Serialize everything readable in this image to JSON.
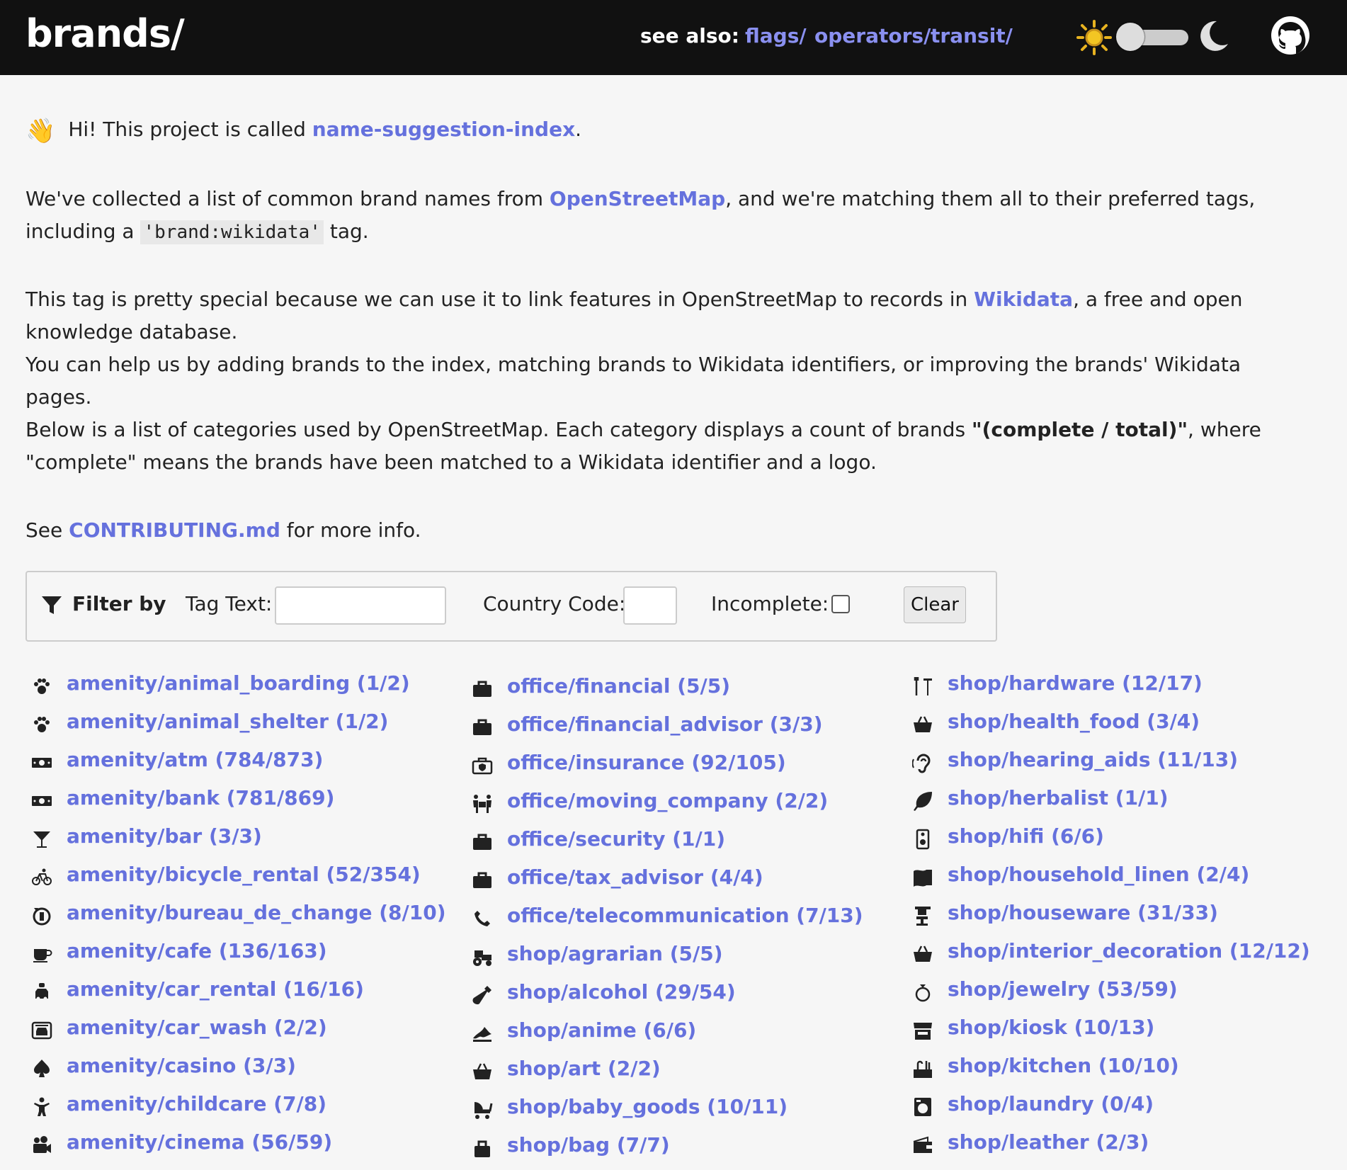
{
  "header": {
    "title": "brands/",
    "see_also_label": "see also:",
    "links": [
      "flags/",
      "operators/",
      "transit/"
    ]
  },
  "intro": {
    "p1_pre": "Hi! This project is called ",
    "p1_link": "name-suggestion-index",
    "p1_post": ".",
    "p2_pre": "We've collected a list of common brand names from ",
    "p2_link": "OpenStreetMap",
    "p2_mid": ", and we're matching them all to their preferred tags, including a ",
    "p2_code": "'brand:wikidata'",
    "p2_post": " tag.",
    "p3_pre": "This tag is pretty special because we can use it to link features in OpenStreetMap to records in ",
    "p3_link": "Wikidata",
    "p3_post": ", a free and open knowledge database.",
    "p3b": "You can help us by adding brands to the index, matching brands to Wikidata identifiers, or improving the brands' Wikidata pages.",
    "p4_pre": "Below is a list of categories used by OpenStreetMap. Each category displays a count of brands ",
    "p4_bold": "\"(complete / total)\"",
    "p4_post": ", where \"complete\" means the brands have been matched to a Wikidata identifier and a logo.",
    "p5_pre": "See ",
    "p5_link": "CONTRIBUTING.md",
    "p5_post": " for more info."
  },
  "filter": {
    "title": "Filter by",
    "tag_label": "Tag Text:",
    "tag_value": "",
    "country_label": "Country Code:",
    "country_value": "",
    "incomplete_label": "Incomplete:",
    "clear_label": "Clear"
  },
  "columns": [
    [
      {
        "label": "amenity/animal_boarding (1/2)",
        "icon": "paw-icon"
      },
      {
        "label": "amenity/animal_shelter (1/2)",
        "icon": "paw-icon"
      },
      {
        "label": "amenity/atm (784/873)",
        "icon": "money-bill-icon"
      },
      {
        "label": "amenity/bank (781/869)",
        "icon": "money-bill-icon"
      },
      {
        "label": "amenity/bar (3/3)",
        "icon": "cocktail-icon"
      },
      {
        "label": "amenity/bicycle_rental (52/354)",
        "icon": "bicycle-icon"
      },
      {
        "label": "amenity/bureau_de_change (8/10)",
        "icon": "exchange-icon"
      },
      {
        "label": "amenity/cafe (136/163)",
        "icon": "coffee-icon"
      },
      {
        "label": "amenity/car_rental (16/16)",
        "icon": "car-key-icon"
      },
      {
        "label": "amenity/car_wash (2/2)",
        "icon": "car-wash-icon"
      },
      {
        "label": "amenity/casino (3/3)",
        "icon": "spade-icon"
      },
      {
        "label": "amenity/childcare (7/8)",
        "icon": "child-icon"
      },
      {
        "label": "amenity/cinema (56/59)",
        "icon": "film-camera-icon"
      }
    ],
    [
      {
        "label": "office/financial (5/5)",
        "icon": "briefcase-icon"
      },
      {
        "label": "office/financial_advisor (3/3)",
        "icon": "briefcase-icon"
      },
      {
        "label": "office/insurance (92/105)",
        "icon": "insurance-briefcase-icon"
      },
      {
        "label": "office/moving_company (2/2)",
        "icon": "people-carry-icon"
      },
      {
        "label": "office/security (1/1)",
        "icon": "briefcase-icon"
      },
      {
        "label": "office/tax_advisor (4/4)",
        "icon": "briefcase-icon"
      },
      {
        "label": "office/telecommunication (7/13)",
        "icon": "phone-icon"
      },
      {
        "label": "shop/agrarian (5/5)",
        "icon": "tractor-icon"
      },
      {
        "label": "shop/alcohol (29/54)",
        "icon": "wine-bottle-icon"
      },
      {
        "label": "shop/anime (6/6)",
        "icon": "wave-icon"
      },
      {
        "label": "shop/art (2/2)",
        "icon": "basket-icon"
      },
      {
        "label": "shop/baby_goods (10/11)",
        "icon": "stroller-icon"
      },
      {
        "label": "shop/bag (7/7)",
        "icon": "bag-icon"
      }
    ],
    [
      {
        "label": "shop/hardware (12/17)",
        "icon": "tools-icon"
      },
      {
        "label": "shop/health_food (3/4)",
        "icon": "basket-icon"
      },
      {
        "label": "shop/hearing_aids (11/13)",
        "icon": "ear-icon"
      },
      {
        "label": "shop/herbalist (1/1)",
        "icon": "leaf-icon"
      },
      {
        "label": "shop/hifi (6/6)",
        "icon": "speaker-icon"
      },
      {
        "label": "shop/household_linen (2/4)",
        "icon": "linen-icon"
      },
      {
        "label": "shop/houseware (31/33)",
        "icon": "blender-icon"
      },
      {
        "label": "shop/interior_decoration (12/12)",
        "icon": "basket-icon"
      },
      {
        "label": "shop/jewelry (53/59)",
        "icon": "ring-icon"
      },
      {
        "label": "shop/kiosk (10/13)",
        "icon": "store-icon"
      },
      {
        "label": "shop/kitchen (10/10)",
        "icon": "kitchen-icon"
      },
      {
        "label": "shop/laundry (0/4)",
        "icon": "washing-machine-icon"
      },
      {
        "label": "shop/leather (2/3)",
        "icon": "wallet-icon"
      }
    ]
  ]
}
